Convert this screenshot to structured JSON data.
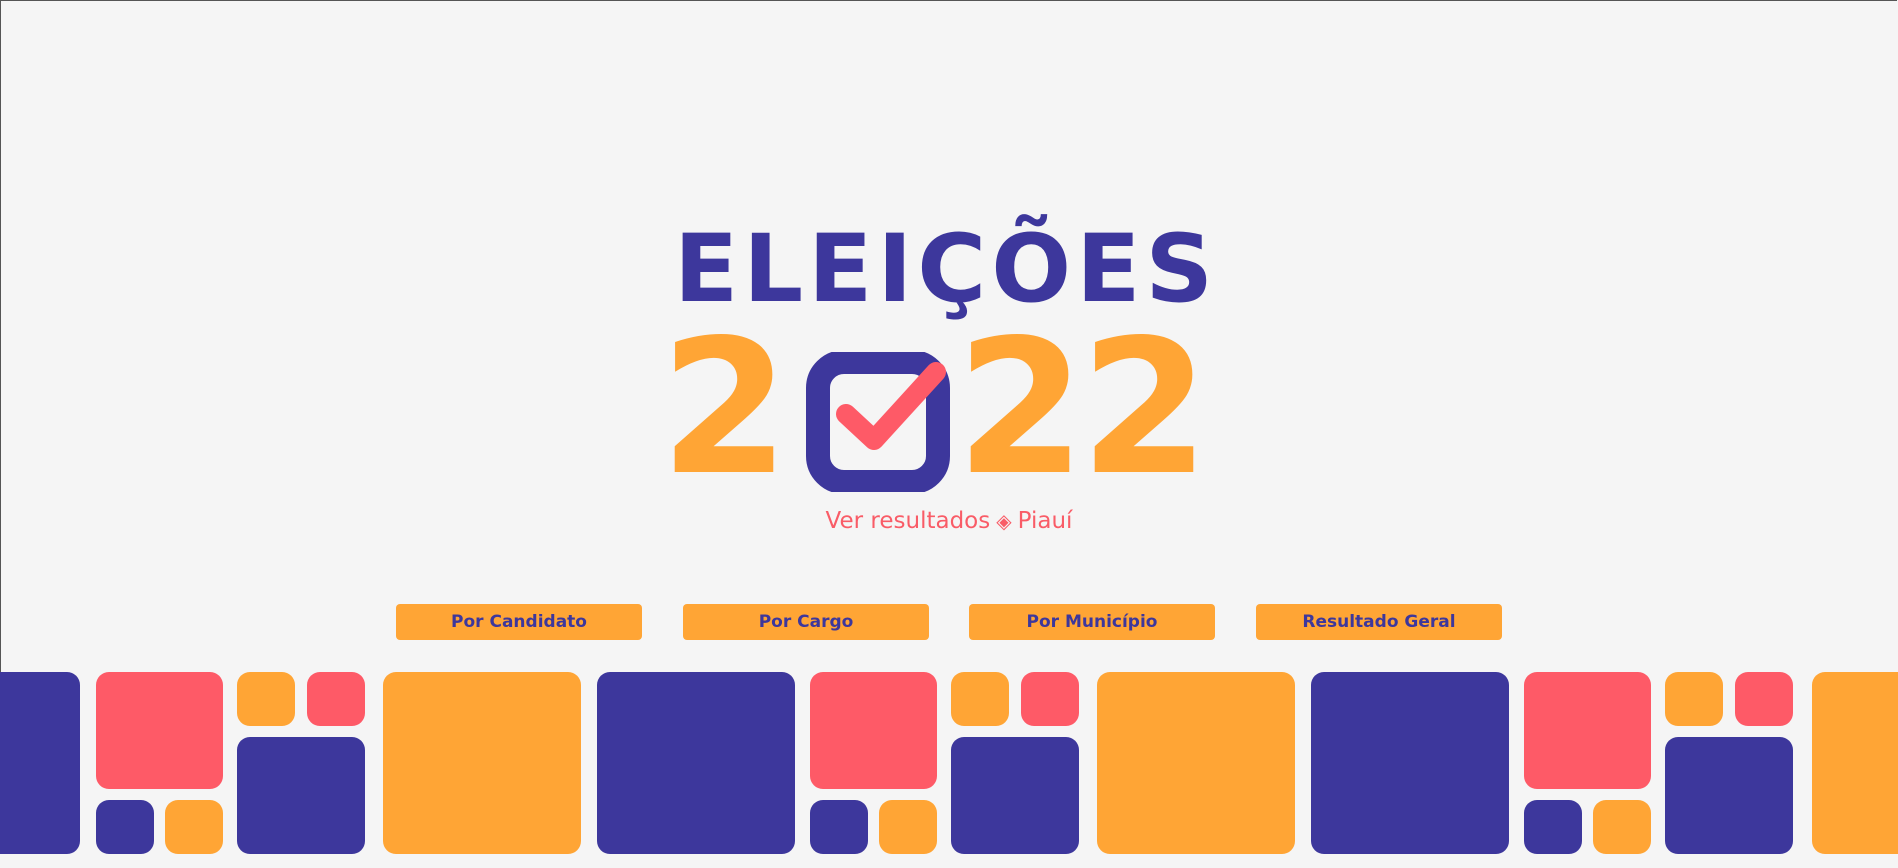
{
  "logo": {
    "title": "ELEIÇÕES",
    "year_digits": [
      "2",
      "2",
      "2"
    ],
    "check_icon": "checkbox-checked-icon"
  },
  "tagline": {
    "prefix": "Ver resultados",
    "separator": "◈",
    "state": "Piauí"
  },
  "nav": {
    "by_candidate": "Por Candidato",
    "by_office": "Por Cargo",
    "by_municipality": "Por Município",
    "overall_result": "Resultado Geral"
  },
  "colors": {
    "navy": "#3d379c",
    "coral": "#fe5a67",
    "orange": "#ffa535",
    "background": "#f5f5f5"
  }
}
